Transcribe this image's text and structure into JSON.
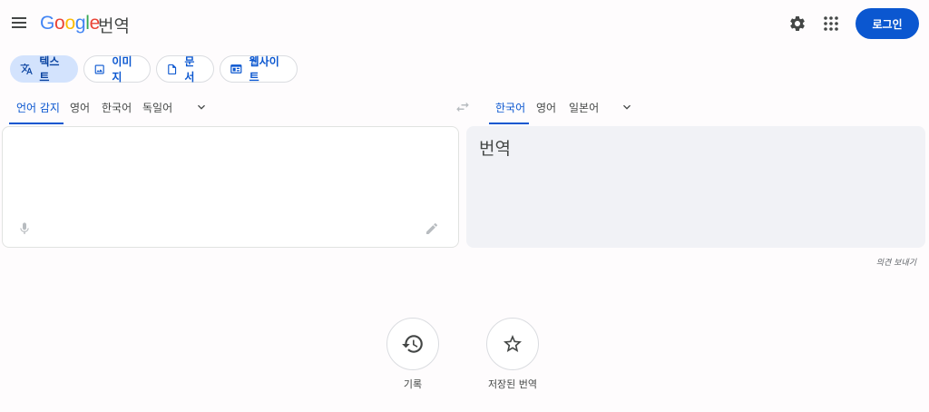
{
  "header": {
    "logo_letters": [
      "G",
      "o",
      "o",
      "g",
      "l",
      "e"
    ],
    "product": "번역",
    "login_label": "로그인"
  },
  "icons": {
    "menu": "menu-icon",
    "settings": "gear-icon",
    "apps": "apps-grid-icon",
    "swap": "swap-arrows-icon",
    "mic": "microphone-icon",
    "handwrite": "pencil-icon",
    "history": "history-icon",
    "saved": "star-icon"
  },
  "modes": [
    {
      "label": "텍스트",
      "active": true
    },
    {
      "label": "이미지",
      "active": false
    },
    {
      "label": "문서",
      "active": false
    },
    {
      "label": "웹사이트",
      "active": false
    }
  ],
  "source_langs": [
    "언어 감지",
    "영어",
    "한국어",
    "독일어"
  ],
  "target_langs": [
    "한국어",
    "영어",
    "일본어"
  ],
  "source": {
    "value": ""
  },
  "target": {
    "placeholder": "번역"
  },
  "feedback_label": "의견 보내기",
  "bottom": {
    "history_label": "기록",
    "saved_label": "저장된 번역"
  },
  "colors": {
    "accent": "#0b57d0",
    "active_chip": "#d3e3fd",
    "target_bg": "#f1f2f6"
  }
}
